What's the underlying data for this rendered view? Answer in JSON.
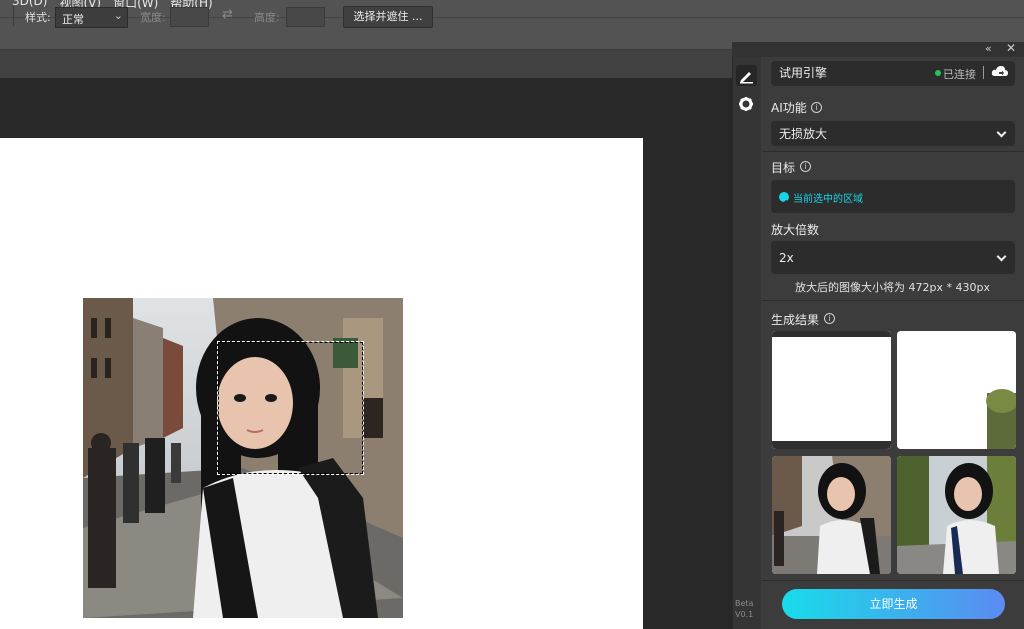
{
  "menu": [
    "3D(D)",
    "视图(V)",
    "窗口(W)",
    "帮助(H)"
  ],
  "options": {
    "style_label": "样式:",
    "style_value": "正常",
    "width_label": "宽度:",
    "height_label": "高度:",
    "select_mask_label": "选择并遮住 ..."
  },
  "panel": {
    "engine": {
      "name": "试用引擎",
      "status": "已连接",
      "status_color": "#22c55e"
    },
    "ai_function": {
      "label": "AI功能",
      "value": "无损放大"
    },
    "target": {
      "label": "目标",
      "value": "当前选中的区域",
      "color": "#18d6e6"
    },
    "scale": {
      "label": "放大倍数",
      "value": "2x",
      "note": "放大后的图像大小将为 472px * 430px"
    },
    "results": {
      "label": "生成结果"
    },
    "generate_label": "立即生成",
    "version": [
      "Beta",
      "V0.1"
    ]
  }
}
